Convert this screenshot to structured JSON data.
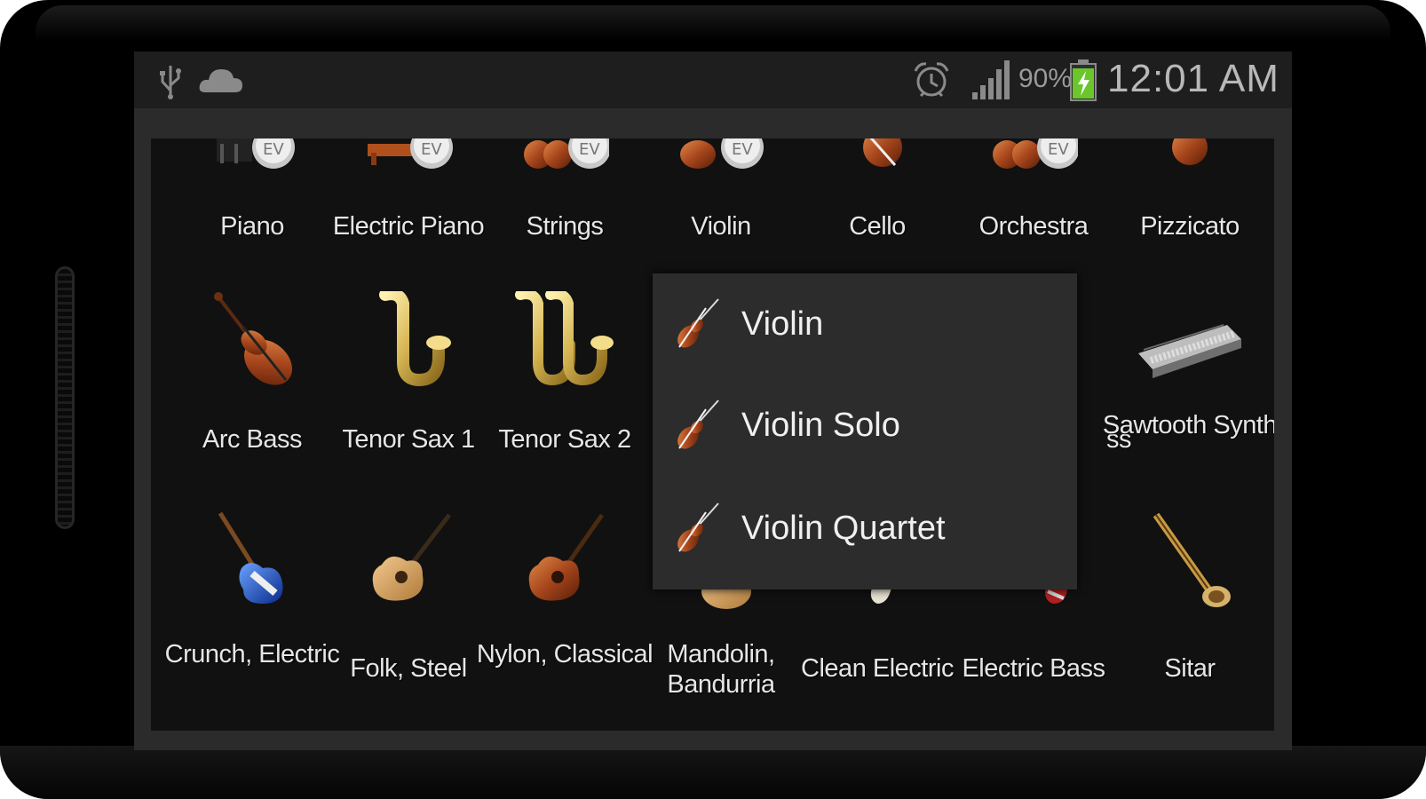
{
  "status_bar": {
    "icons": [
      "usb-icon",
      "cloud-icon",
      "alarm-icon",
      "signal-icon",
      "battery-charging-icon"
    ],
    "battery_percent": "90%",
    "time": "12:01 AM"
  },
  "instruments": {
    "row1": [
      "Piano",
      "Electric Piano",
      "Strings",
      "Violin",
      "Cello",
      "Orchestra",
      "Pizzicato"
    ],
    "row2": [
      "Arc Bass",
      "Tenor Sax 1",
      "Tenor Sax 2",
      "",
      "",
      "ss",
      "Sawtooth Synth"
    ],
    "row3": [
      "Crunch, Electric",
      "Folk, Steel",
      "Nylon, Classical",
      "Mandolin, Bandurria",
      "Clean Electric",
      "Electric Bass",
      "Sitar"
    ]
  },
  "popup": {
    "items": [
      "Violin",
      "Violin Solo",
      "Violin Quartet"
    ]
  }
}
